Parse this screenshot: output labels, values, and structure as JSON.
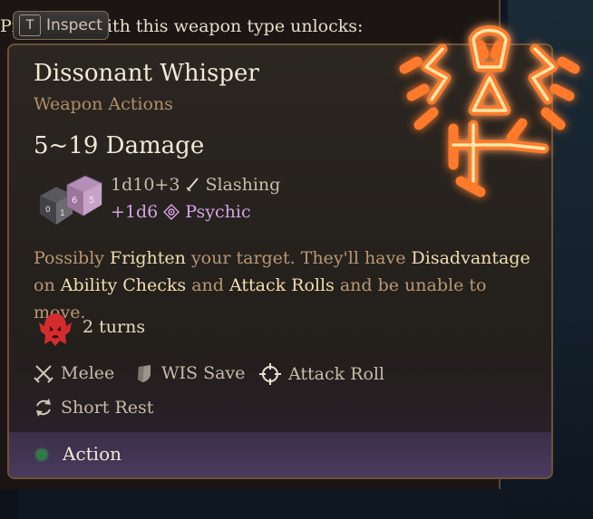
{
  "background_panel": {
    "text": "Pr",
    "text_tail": "ith this weapon type unlocks:"
  },
  "inspect": {
    "key": "T",
    "label": "Inspect"
  },
  "tooltip": {
    "title": "Dissonant Whisper",
    "subtitle": "Weapon Actions",
    "damage": "5~19 Damage",
    "damage_lines": [
      {
        "dice": "1d10+3",
        "type": "Slashing",
        "icon": "slashing-icon"
      },
      {
        "dice": "+1d6",
        "type": "Psychic",
        "icon": "psychic-icon"
      }
    ],
    "description": {
      "p1": "Possibly ",
      "k1": "Frighten",
      "p2": " your target. They'll have ",
      "k2": "Disadvantage",
      "p3": " on ",
      "k3": "Ability Checks",
      "p4": " and ",
      "k4": "Attack Rolls",
      "p5": " and be unable to move."
    },
    "duration": "2 turns",
    "properties": [
      {
        "label": "Melee",
        "icon": "melee-icon"
      },
      {
        "label": "WIS Save",
        "icon": "shield-save-icon"
      },
      {
        "label": "Attack Roll",
        "icon": "crosshair-icon"
      },
      {
        "label": "Short Rest",
        "icon": "refresh-icon"
      }
    ],
    "footer": {
      "label": "Action",
      "dot_color": "#2f7a44"
    }
  },
  "colors": {
    "keyword": "#f2deb1",
    "psychic": "#d6a3e8",
    "subtitle": "#b28e66",
    "border": "#6e5236"
  }
}
